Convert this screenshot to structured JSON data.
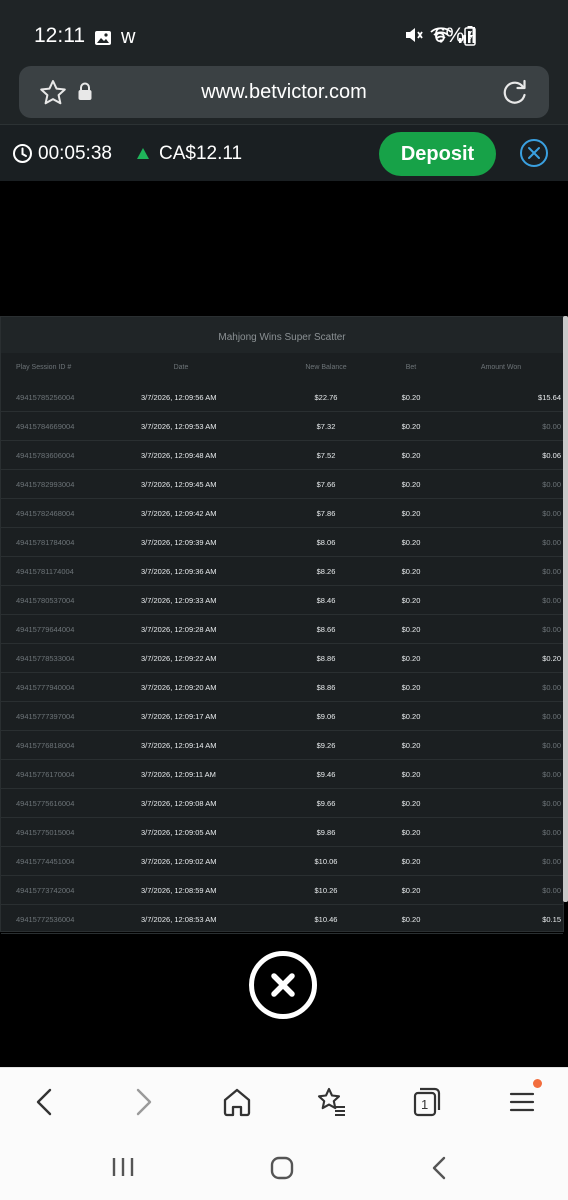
{
  "status": {
    "time": "12:11",
    "app_letter": "w",
    "battery": "6%"
  },
  "browser": {
    "url": "www.betvictor.com"
  },
  "account": {
    "timer": "00:05:38",
    "balance": "CA$12.11",
    "deposit_label": "Deposit"
  },
  "history": {
    "title": "Mahjong Wins Super Scatter",
    "columns": [
      "Play Session ID #",
      "Date",
      "New Balance",
      "Bet",
      "Amount Won"
    ],
    "rows": [
      {
        "id": "49415785256004",
        "date": "3/7/2026, 12:09:56 AM",
        "balance": "$22.76",
        "bet": "$0.20",
        "won": "$15.64"
      },
      {
        "id": "49415784669004",
        "date": "3/7/2026, 12:09:53 AM",
        "balance": "$7.32",
        "bet": "$0.20",
        "won": "$0.00"
      },
      {
        "id": "49415783606004",
        "date": "3/7/2026, 12:09:48 AM",
        "balance": "$7.52",
        "bet": "$0.20",
        "won": "$0.06"
      },
      {
        "id": "49415782993004",
        "date": "3/7/2026, 12:09:45 AM",
        "balance": "$7.66",
        "bet": "$0.20",
        "won": "$0.00"
      },
      {
        "id": "49415782468004",
        "date": "3/7/2026, 12:09:42 AM",
        "balance": "$7.86",
        "bet": "$0.20",
        "won": "$0.00"
      },
      {
        "id": "49415781784004",
        "date": "3/7/2026, 12:09:39 AM",
        "balance": "$8.06",
        "bet": "$0.20",
        "won": "$0.00"
      },
      {
        "id": "49415781174004",
        "date": "3/7/2026, 12:09:36 AM",
        "balance": "$8.26",
        "bet": "$0.20",
        "won": "$0.00"
      },
      {
        "id": "49415780537004",
        "date": "3/7/2026, 12:09:33 AM",
        "balance": "$8.46",
        "bet": "$0.20",
        "won": "$0.00"
      },
      {
        "id": "49415779644004",
        "date": "3/7/2026, 12:09:28 AM",
        "balance": "$8.66",
        "bet": "$0.20",
        "won": "$0.00"
      },
      {
        "id": "49415778533004",
        "date": "3/7/2026, 12:09:22 AM",
        "balance": "$8.86",
        "bet": "$0.20",
        "won": "$0.20"
      },
      {
        "id": "49415777940004",
        "date": "3/7/2026, 12:09:20 AM",
        "balance": "$8.86",
        "bet": "$0.20",
        "won": "$0.00"
      },
      {
        "id": "49415777397004",
        "date": "3/7/2026, 12:09:17 AM",
        "balance": "$9.06",
        "bet": "$0.20",
        "won": "$0.00"
      },
      {
        "id": "49415776818004",
        "date": "3/7/2026, 12:09:14 AM",
        "balance": "$9.26",
        "bet": "$0.20",
        "won": "$0.00"
      },
      {
        "id": "49415776170004",
        "date": "3/7/2026, 12:09:11 AM",
        "balance": "$9.46",
        "bet": "$0.20",
        "won": "$0.00"
      },
      {
        "id": "49415775616004",
        "date": "3/7/2026, 12:09:08 AM",
        "balance": "$9.66",
        "bet": "$0.20",
        "won": "$0.00"
      },
      {
        "id": "49415775015004",
        "date": "3/7/2026, 12:09:05 AM",
        "balance": "$9.86",
        "bet": "$0.20",
        "won": "$0.00"
      },
      {
        "id": "49415774451004",
        "date": "3/7/2026, 12:09:02 AM",
        "balance": "$10.06",
        "bet": "$0.20",
        "won": "$0.00"
      },
      {
        "id": "49415773742004",
        "date": "3/7/2026, 12:08:59 AM",
        "balance": "$10.26",
        "bet": "$0.20",
        "won": "$0.00"
      },
      {
        "id": "49415772536004",
        "date": "3/7/2026, 12:08:53 AM",
        "balance": "$10.46",
        "bet": "$0.20",
        "won": "$0.15"
      }
    ]
  },
  "toolbar": {
    "tabs_count": "1"
  },
  "icons": [
    "gallery-icon",
    "mute-icon",
    "wifi-icon",
    "signal-icon",
    "battery-icon",
    "star-icon",
    "lock-icon",
    "reload-icon",
    "clock-icon",
    "close-icon",
    "back-icon",
    "forward-icon",
    "home-icon",
    "bookmarks-icon",
    "tabs-icon",
    "menu-icon",
    "recents-icon",
    "home-nav-icon",
    "back-nav-icon"
  ],
  "colors": {
    "deposit": "#17a248",
    "up_arrow": "#1fb45a",
    "close_accent": "#3aa0e0",
    "menu_badge": "#f26d3d"
  }
}
